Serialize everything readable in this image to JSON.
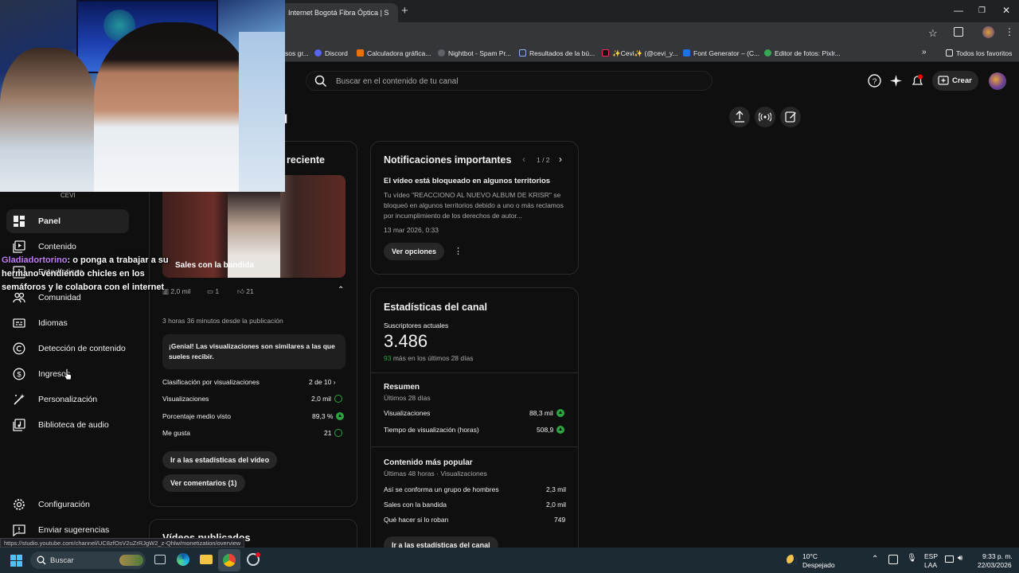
{
  "browser": {
    "tab_title": "Internet Bogotá Fibra Óptica | S",
    "new_tab": "+",
    "bookmarks": [
      {
        "label": "sos gr...",
        "color": "#5f6368"
      },
      {
        "label": "Discord",
        "color": "#5865f2"
      },
      {
        "label": "Calculadora gráfica...",
        "color": "#e8710a"
      },
      {
        "label": "Nightbot - Spam Pr...",
        "color": "#3c4043"
      },
      {
        "label": "Resultados de la bú...",
        "color": "#8ab4f8"
      },
      {
        "label": "✨Cevi✨ (@cevi_y...",
        "color": "#000000"
      },
      {
        "label": "Font Generator – (C...",
        "color": "#1a73e8"
      },
      {
        "label": "Editor de fotos: Pixlr...",
        "color": "#34a853"
      }
    ],
    "favorites_label": "Todos los favoritos",
    "status_url": "https://studio.youtube.com/channel/UC8zfOsV2uZrRJgW2_z-Qhlw/monetization/overview"
  },
  "header": {
    "search_placeholder": "Buscar en el contenido de tu canal",
    "create_label": "Crear",
    "page_title_fragment": "al"
  },
  "webcam": {
    "channel_label": "CEVI"
  },
  "sidebar": {
    "items": [
      {
        "label": "Panel",
        "active": true
      },
      {
        "label": "Contenido"
      },
      {
        "label": "Estadísticas"
      },
      {
        "label": "Comunidad"
      },
      {
        "label": "Idiomas"
      },
      {
        "label": "Detección de contenido"
      },
      {
        "label": "Ingresos"
      },
      {
        "label": "Personalización"
      },
      {
        "label": "Biblioteca de audio"
      }
    ],
    "settings_label": "Configuración",
    "feedback_label": "Enviar sugerencias"
  },
  "chat": {
    "user": "Gladiadortorino",
    "message": ": o ponga a trabajar a su hermano vendiendo chicles en los semáforos y le colabora con el internet"
  },
  "latest_video": {
    "title_fragment": "reciente",
    "video_title": "Sales con la bandida",
    "views": "2,0 mil",
    "comments": "1",
    "likes": "21",
    "time_since": "3 horas 36 minutos desde la publicación",
    "insight": "¡Genial! Las visualizaciones son similares a las que sueles recibir.",
    "rank_label": "Clasificación por visualizaciones",
    "rank_value": "2 de 10",
    "stats": [
      {
        "label": "Visualizaciones",
        "value": "2,0 mil",
        "indicator": "check"
      },
      {
        "label": "Porcentaje medio visto",
        "value": "89,3 %",
        "indicator": "up"
      },
      {
        "label": "Me gusta",
        "value": "21",
        "indicator": "check"
      }
    ],
    "stats_button": "Ir a las estadísticas del vídeo",
    "comments_button": "Ver comentarios (1)",
    "next_card_fragment": "Vídeos publicados"
  },
  "notifications": {
    "title": "Notificaciones importantes",
    "pager": "1 / 2",
    "heading": "El vídeo está bloqueado en algunos territorios",
    "body": "Tu vídeo \"REACCIONO AL NUEVO ALBUM DE KRISR\" se bloqueó en algunos territorios debido a uno o más reclamos por incumplimiento de los derechos de autor...",
    "date": "13 mar 2026, 0:33",
    "options_button": "Ver opciones"
  },
  "channel_stats": {
    "title": "Estadísticas del canal",
    "subs_label": "Suscriptores actuales",
    "subs_value": "3.486",
    "subs_delta": "93",
    "subs_delta_suffix": " más en los últimos 28 días",
    "summary_title": "Resumen",
    "summary_period": "Últimos 28 días",
    "summary": [
      {
        "label": "Visualizaciones",
        "value": "88,3 mil"
      },
      {
        "label": "Tiempo de visualización (horas)",
        "value": "508,9"
      }
    ],
    "popular_title": "Contenido más popular",
    "popular_period": "Últimas 48 horas · Visualizaciones",
    "popular": [
      {
        "label": "Así se conforma un grupo de hombres",
        "value": "2,3 mil"
      },
      {
        "label": "Sales con la bandida",
        "value": "2,0 mil"
      },
      {
        "label": "Qué hacer si lo roban",
        "value": "749"
      }
    ],
    "button": "Ir a las estadísticas del canal"
  },
  "taskbar": {
    "search_label": "Buscar",
    "weather_temp": "10°C",
    "weather_desc": "Despejado",
    "lang_top": "ESP",
    "lang_bottom": "LAA",
    "time": "9:33 p. m.",
    "date": "22/03/2026"
  }
}
